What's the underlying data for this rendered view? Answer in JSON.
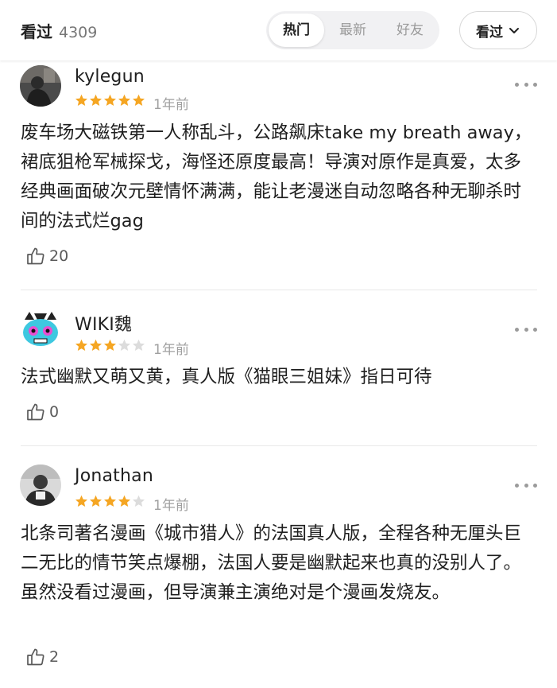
{
  "header": {
    "title": "看过",
    "count": "4309",
    "tabs": [
      {
        "label": "热门",
        "active": true
      },
      {
        "label": "最新",
        "active": false
      },
      {
        "label": "好友",
        "active": false
      }
    ],
    "sort_label": "看过"
  },
  "colors": {
    "star_filled": "#f5a623",
    "star_empty": "#dcdcdc",
    "muted_text": "#a0a0a0"
  },
  "reviews": [
    {
      "username": "kylegun",
      "rating": 5,
      "time": "1年前",
      "content": "废车场大磁铁第一人称乱斗，公路飙床take my breath away，裙底狙枪军械探戈，海怪还原度最高！导演对原作是真爱，太多经典画面破次元壁情怀满满，能让老漫迷自动忽略各种无聊杀时间的法式烂gag",
      "likes": "20"
    },
    {
      "username": "WIKI魏",
      "rating": 3,
      "time": "1年前",
      "content": "法式幽默又萌又黄，真人版《猫眼三姐妹》指日可待",
      "likes": "0"
    },
    {
      "username": "Jonathan",
      "rating": 4,
      "time": "1年前",
      "content": "北条司著名漫画《城市猎人》的法国真人版，全程各种无厘头巨二无比的情节笑点爆棚，法国人要是幽默起来也真的没别人了。虽然没看过漫画，但导演兼主演绝对是个漫画发烧友。",
      "likes": "2"
    }
  ]
}
